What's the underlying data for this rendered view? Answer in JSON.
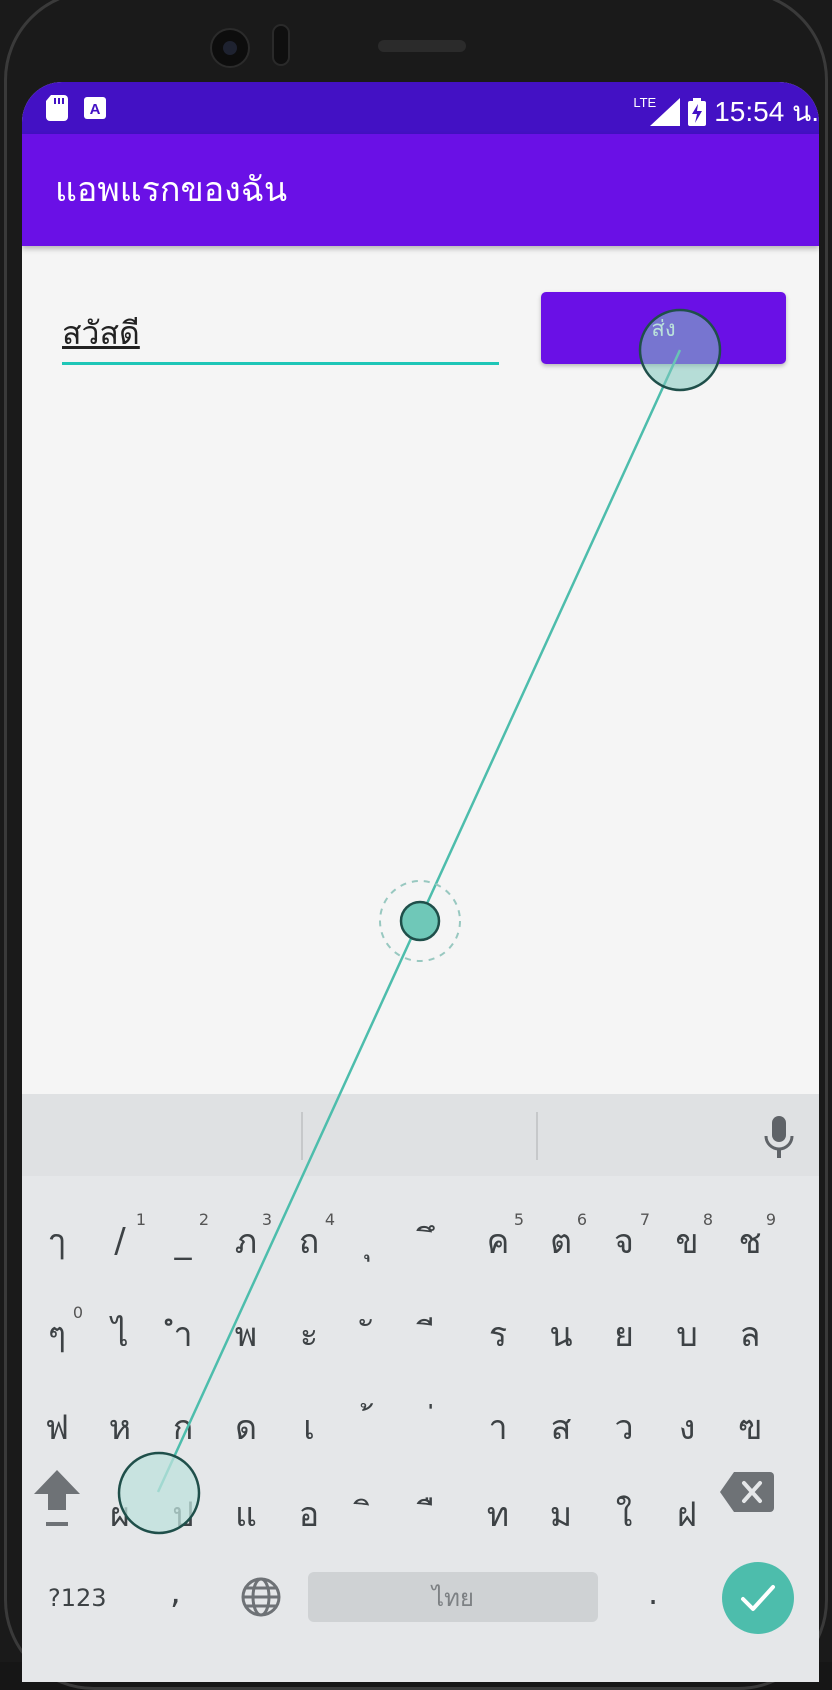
{
  "status": {
    "network": "LTE",
    "time": "15:54 น."
  },
  "app": {
    "title": "แอพแรกของฉัน"
  },
  "form": {
    "input_value": "สวัสดี",
    "send_label": "ส่ง"
  },
  "keyboard": {
    "row1": [
      {
        "k": "ๅ",
        "h": ""
      },
      {
        "k": "/",
        "h": "1"
      },
      {
        "k": "_",
        "h": "2"
      },
      {
        "k": "ภ",
        "h": "3"
      },
      {
        "k": "ถ",
        "h": "4"
      },
      {
        "k": "ุ",
        "h": ""
      },
      {
        "k": "ึ",
        "h": ""
      },
      {
        "k": "ค",
        "h": "5"
      },
      {
        "k": "ต",
        "h": "6"
      },
      {
        "k": "จ",
        "h": "7"
      },
      {
        "k": "ข",
        "h": "8"
      },
      {
        "k": "ช",
        "h": "9"
      }
    ],
    "row2": [
      {
        "k": "ๆ",
        "h": "0"
      },
      {
        "k": "ไ",
        "h": ""
      },
      {
        "k": "ำ",
        "h": ""
      },
      {
        "k": "พ",
        "h": ""
      },
      {
        "k": "ะ",
        "h": ""
      },
      {
        "k": "ั",
        "h": ""
      },
      {
        "k": "ี",
        "h": ""
      },
      {
        "k": "ร",
        "h": ""
      },
      {
        "k": "น",
        "h": ""
      },
      {
        "k": "ย",
        "h": ""
      },
      {
        "k": "บ",
        "h": ""
      },
      {
        "k": "ล",
        "h": ""
      }
    ],
    "row3": [
      {
        "k": "ฟ",
        "h": ""
      },
      {
        "k": "ห",
        "h": ""
      },
      {
        "k": "ก",
        "h": ""
      },
      {
        "k": "ด",
        "h": ""
      },
      {
        "k": "เ",
        "h": ""
      },
      {
        "k": "้",
        "h": ""
      },
      {
        "k": "่",
        "h": ""
      },
      {
        "k": "า",
        "h": ""
      },
      {
        "k": "ส",
        "h": ""
      },
      {
        "k": "ว",
        "h": ""
      },
      {
        "k": "ง",
        "h": ""
      },
      {
        "k": "ฃ",
        "h": ""
      }
    ],
    "row4": [
      {
        "k": "ผ",
        "h": ""
      },
      {
        "k": "ป",
        "h": ""
      },
      {
        "k": "แ",
        "h": ""
      },
      {
        "k": "อ",
        "h": ""
      },
      {
        "k": "ิ",
        "h": ""
      },
      {
        "k": "ื",
        "h": ""
      },
      {
        "k": "ท",
        "h": ""
      },
      {
        "k": "ม",
        "h": ""
      },
      {
        "k": "ใ",
        "h": ""
      },
      {
        "k": "ฝ",
        "h": ""
      }
    ],
    "symbols_label": "?123",
    "comma": ",",
    "space_label": "ไทย",
    "period": "."
  },
  "colors": {
    "status_bar": "#4311c4",
    "app_bar": "#6a10e6",
    "accent": "#1fc6b7",
    "touch": "#4dbdac"
  }
}
